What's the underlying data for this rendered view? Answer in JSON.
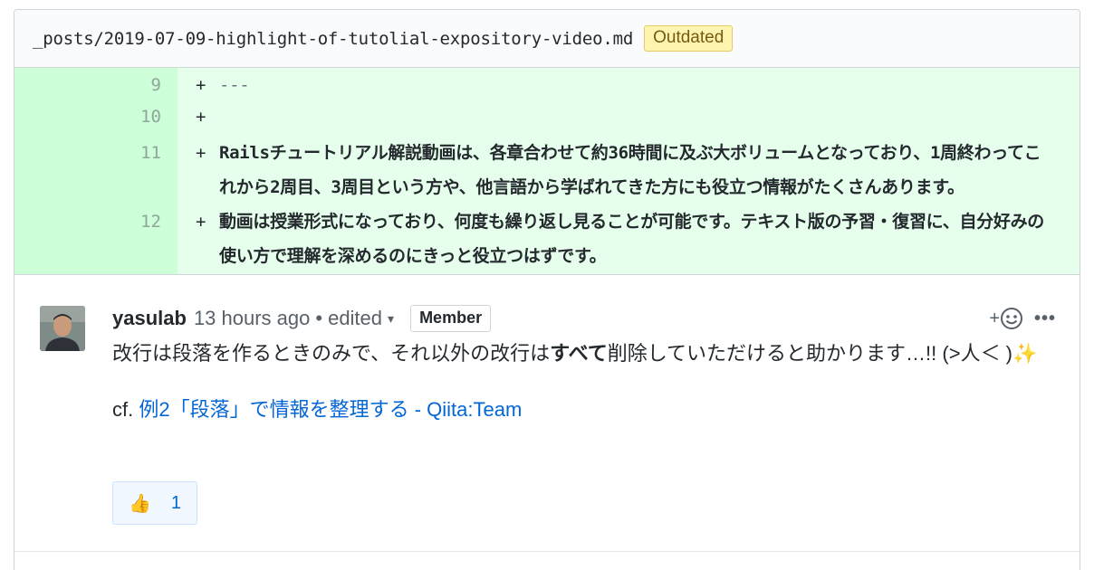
{
  "file": {
    "path": "_posts/2019-07-09-highlight-of-tutolial-expository-video.md",
    "badge": "Outdated"
  },
  "diff": {
    "lines": [
      {
        "num": "9",
        "marker": "+",
        "text": "---"
      },
      {
        "num": "10",
        "marker": "+",
        "text": ""
      },
      {
        "num": "11",
        "marker": "+",
        "text": "Railsチュートリアル解説動画は、各章合わせて約36時間に及ぶ大ボリュームとなっており、1周終わってこれから2周目、3周目という方や、他言語から学ばれてきた方にも役立つ情報がたくさんあります。"
      },
      {
        "num": "12",
        "marker": "+",
        "text": "動画は授業形式になっており、何度も繰り返し見ることが可能です。テキスト版の予習・復習に、自分好みの使い方で理解を深めるのにきっと役立つはずです。"
      }
    ]
  },
  "comment": {
    "author": "yasulab",
    "time": "13 hours ago",
    "dot": "•",
    "edited": "edited",
    "caret": "▾",
    "role_badge": "Member",
    "add_reaction_plus": "+",
    "add_reaction_face": "☺",
    "more": "•••",
    "body_before": "改行は段落を作るときのみで、それ以外の改行は",
    "body_bold": "すべて",
    "body_after": "削除していただけると助かります…!! (>人＜ )✨",
    "cf_prefix": "cf. ",
    "cf_link": "例2「段落」で情報を整理する - Qiita:Team",
    "reaction_emoji": "👍",
    "reaction_count": "1"
  },
  "colors": {
    "diff_added_bg": "#e6ffed",
    "diff_added_num_bg": "#cdffd8",
    "link": "#0366d6",
    "outdated_bg": "#fff5b1"
  }
}
